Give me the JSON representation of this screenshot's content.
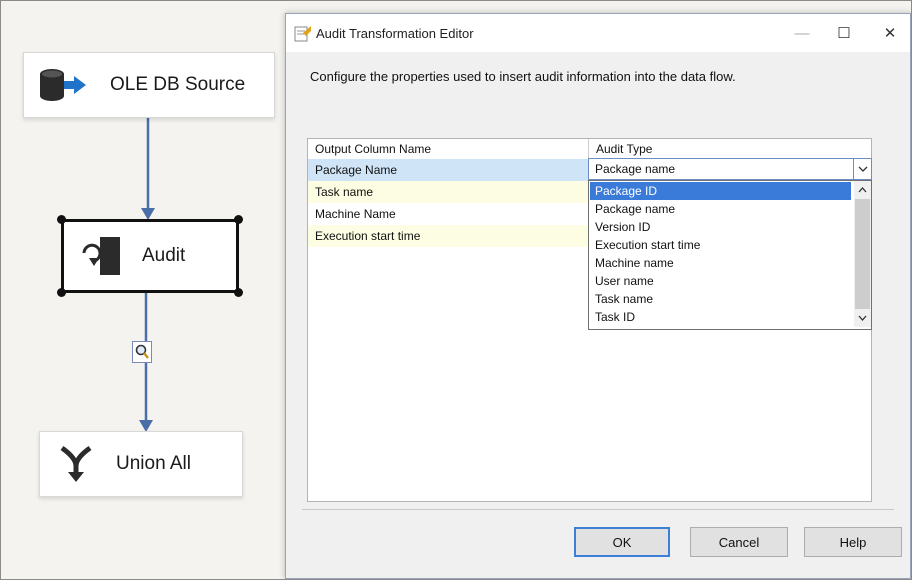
{
  "canvas": {
    "nodes": [
      {
        "label": "OLE DB Source",
        "icon": "database-source-icon"
      },
      {
        "label": "Audit",
        "icon": "audit-transform-icon"
      },
      {
        "label": "Union All",
        "icon": "union-all-icon"
      }
    ],
    "data_viewer_icon": "magnifier-icon"
  },
  "dialog": {
    "title": "Audit Transformation Editor",
    "instructions": "Configure the properties used to insert audit information into the data flow.",
    "columns": [
      "Output Column Name",
      "Audit Type"
    ],
    "rows": [
      {
        "name": "Package Name",
        "type": "Package name"
      },
      {
        "name": "Task name",
        "type": ""
      },
      {
        "name": "Machine Name",
        "type": ""
      },
      {
        "name": "Execution start time",
        "type": ""
      }
    ],
    "dropdown": {
      "selected": "Package ID",
      "options": [
        "Package ID",
        "Package name",
        "Version ID",
        "Execution start time",
        "Machine name",
        "User name",
        "Task name",
        "Task ID"
      ]
    },
    "buttons": {
      "ok": "OK",
      "cancel": "Cancel",
      "help": "Help"
    },
    "window_controls": {
      "minimize": "—",
      "maximize": "☐",
      "close": "✕"
    }
  },
  "colors": {
    "selection": "#3a7ad8",
    "row_highlight": "#cfe4f7",
    "row_yellow": "#fdfde3",
    "connector": "#4a6ea8"
  }
}
